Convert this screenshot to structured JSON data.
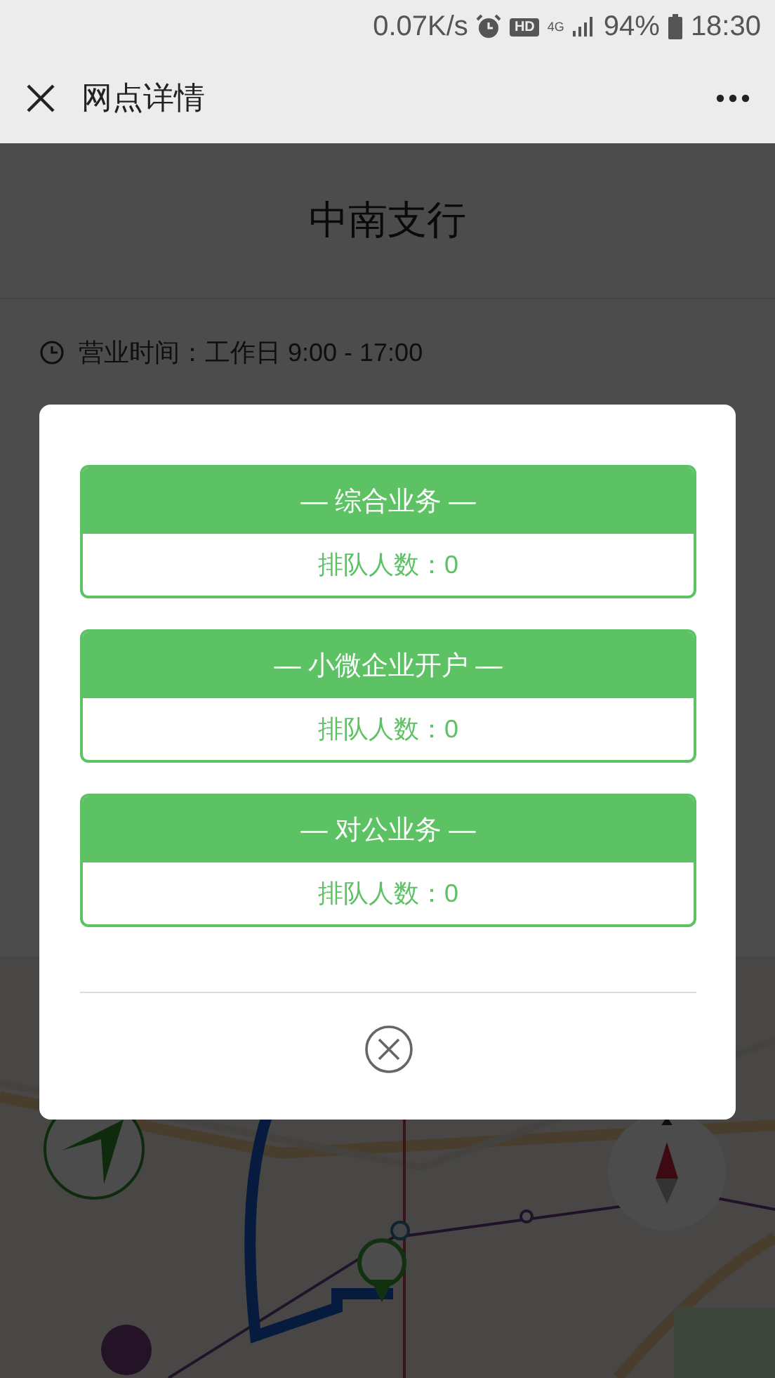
{
  "status_bar": {
    "network_speed": "0.07K/s",
    "hd": "HD",
    "network": "4G",
    "battery": "94%",
    "time": "18:30"
  },
  "nav": {
    "title": "网点详情"
  },
  "branch": {
    "name": "中南支行",
    "hours": "营业时间：工作日 9:00 - 17:00"
  },
  "dialog": {
    "services": [
      {
        "name": "— 综合业务 —",
        "queue": "排队人数：0"
      },
      {
        "name": "— 小微企业开户 —",
        "queue": "排队人数：0"
      },
      {
        "name": "— 对公业务 —",
        "queue": "排队人数：0"
      }
    ]
  }
}
